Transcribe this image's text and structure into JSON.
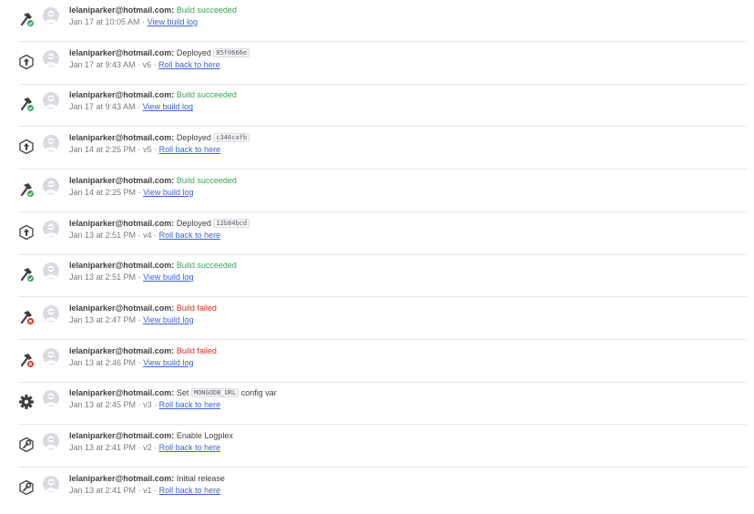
{
  "activity": [
    {
      "kind": "build",
      "status": "success",
      "user": "lelaniparker@hotmail.com:",
      "message": "Build succeeded",
      "code": "",
      "suffix": "",
      "timestamp": "Jan 17 at 10:05 AM",
      "version": "",
      "link": "View build log"
    },
    {
      "kind": "deploy",
      "status": "",
      "user": "lelaniparker@hotmail.com:",
      "message": "Deployed",
      "code": "85f0666e",
      "suffix": "",
      "timestamp": "Jan 17 at 9:43 AM",
      "version": "v6",
      "link": "Roll back to here"
    },
    {
      "kind": "build",
      "status": "success",
      "user": "lelaniparker@hotmail.com:",
      "message": "Build succeeded",
      "code": "",
      "suffix": "",
      "timestamp": "Jan 17 at 9:43 AM",
      "version": "",
      "link": "View build log"
    },
    {
      "kind": "deploy",
      "status": "",
      "user": "lelaniparker@hotmail.com:",
      "message": "Deployed",
      "code": "c346cafb",
      "suffix": "",
      "timestamp": "Jan 14 at 2:25 PM",
      "version": "v5",
      "link": "Roll back to here"
    },
    {
      "kind": "build",
      "status": "success",
      "user": "lelaniparker@hotmail.com:",
      "message": "Build succeeded",
      "code": "",
      "suffix": "",
      "timestamp": "Jan 14 at 2:25 PM",
      "version": "",
      "link": "View build log"
    },
    {
      "kind": "deploy",
      "status": "",
      "user": "lelaniparker@hotmail.com:",
      "message": "Deployed",
      "code": "12b84bcd",
      "suffix": "",
      "timestamp": "Jan 13 at 2:51 PM",
      "version": "v4",
      "link": "Roll back to here"
    },
    {
      "kind": "build",
      "status": "success",
      "user": "lelaniparker@hotmail.com:",
      "message": "Build succeeded",
      "code": "",
      "suffix": "",
      "timestamp": "Jan 13 at 2:51 PM",
      "version": "",
      "link": "View build log"
    },
    {
      "kind": "build",
      "status": "failed",
      "user": "lelaniparker@hotmail.com:",
      "message": "Build failed",
      "code": "",
      "suffix": "",
      "timestamp": "Jan 13 at 2:47 PM",
      "version": "",
      "link": "View build log"
    },
    {
      "kind": "build",
      "status": "failed",
      "user": "lelaniparker@hotmail.com:",
      "message": "Build failed",
      "code": "",
      "suffix": "",
      "timestamp": "Jan 13 at 2:46 PM",
      "version": "",
      "link": "View build log"
    },
    {
      "kind": "config",
      "status": "",
      "user": "lelaniparker@hotmail.com:",
      "message": "Set",
      "code": "MONGODB_URL",
      "suffix": "config var",
      "timestamp": "Jan 13 at 2:45 PM",
      "version": "v3",
      "link": "Roll back to here"
    },
    {
      "kind": "addon",
      "status": "",
      "user": "lelaniparker@hotmail.com:",
      "message": "Enable Logplex",
      "code": "",
      "suffix": "",
      "timestamp": "Jan 13 at 2:41 PM",
      "version": "v2",
      "link": "Roll back to here"
    },
    {
      "kind": "addon",
      "status": "",
      "user": "lelaniparker@hotmail.com:",
      "message": "Initial release",
      "code": "",
      "suffix": "",
      "timestamp": "Jan 13 at 2:41 PM",
      "version": "v1",
      "link": "Roll back to here"
    }
  ],
  "separator": "·",
  "icons": {
    "build": "hammer-icon",
    "deploy": "deploy-arrow-icon",
    "config": "gear-icon",
    "addon": "wrench-icon"
  },
  "colors": {
    "success": "#3aa35a",
    "failed": "#d2301f",
    "link": "#3f63d4",
    "icon": "#3f3f44",
    "divider": "#e7e7ec"
  }
}
